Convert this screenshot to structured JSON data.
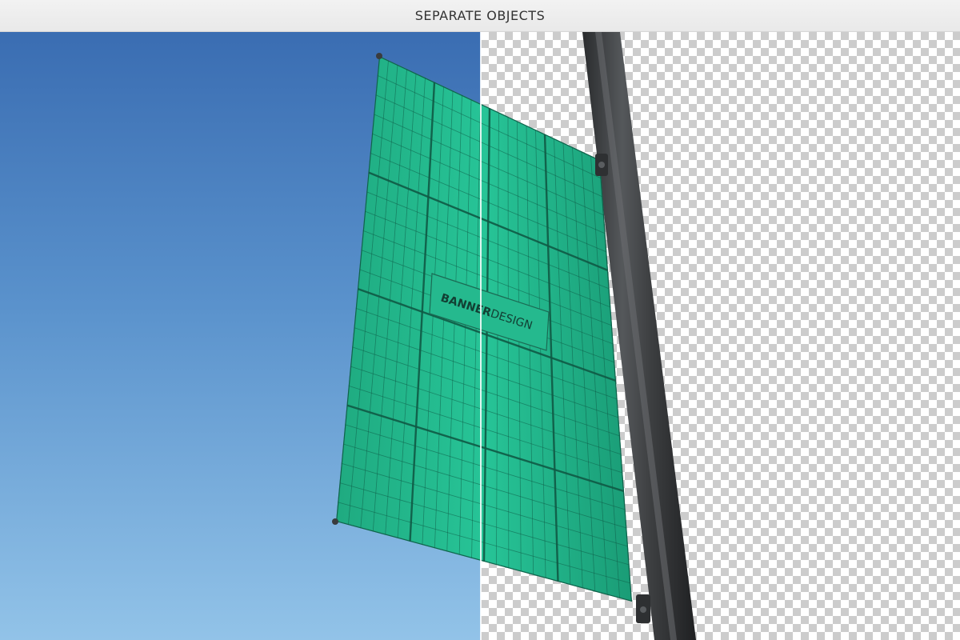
{
  "header": {
    "title": "SEPARATE OBJECTS"
  },
  "banner": {
    "logo_bold": "BANNER",
    "logo_regular": "DESIGN",
    "color": "#22b98d",
    "grid_color": "#0f5a45"
  },
  "pole": {
    "color": "#3d3f41"
  },
  "colors": {
    "sky_top": "#3a6db2",
    "sky_bottom": "#92c3e8"
  }
}
